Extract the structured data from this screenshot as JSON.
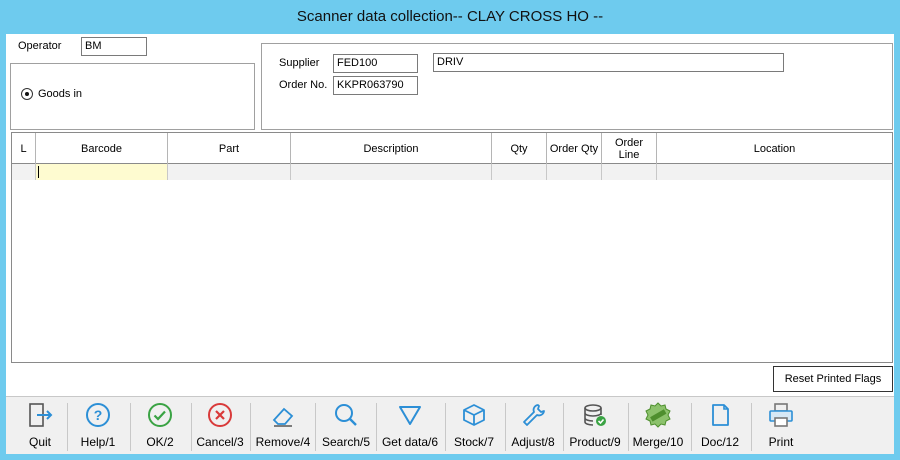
{
  "window": {
    "title": "Scanner data collection-- CLAY CROSS HO --"
  },
  "operator": {
    "label": "Operator",
    "value": "BM"
  },
  "mode": {
    "label": "Goods in",
    "selected": true
  },
  "supplier": {
    "label": "Supplier",
    "code": "FED100",
    "name": "DRIV"
  },
  "order": {
    "label": "Order No.",
    "value": "KKPR063790"
  },
  "grid": {
    "columns": [
      "L",
      "Barcode",
      "Part",
      "Description",
      "Qty",
      "Order Qty",
      "Order\nLine",
      "Location"
    ],
    "rows": [
      [
        "",
        "",
        "",
        "",
        "",
        "",
        "",
        ""
      ]
    ]
  },
  "reset_button": "Reset Printed Flags",
  "toolbar": [
    {
      "label": "Quit",
      "icon": "exit-door-icon"
    },
    {
      "label": "Help/1",
      "icon": "help-icon"
    },
    {
      "label": "OK/2",
      "icon": "check-circle-icon"
    },
    {
      "label": "Cancel/3",
      "icon": "cancel-circle-icon"
    },
    {
      "label": "Remove/4",
      "icon": "eraser-icon"
    },
    {
      "label": "Search/5",
      "icon": "magnifier-icon"
    },
    {
      "label": "Get data/6",
      "icon": "funnel-icon"
    },
    {
      "label": "Stock/7",
      "icon": "box-icon"
    },
    {
      "label": "Adjust/8",
      "icon": "wrench-icon"
    },
    {
      "label": "Product/9",
      "icon": "database-check-icon"
    },
    {
      "label": "Merge/10",
      "icon": "special-badge-icon"
    },
    {
      "label": "Doc/12",
      "icon": "document-icon"
    },
    {
      "label": "Print",
      "icon": "printer-icon"
    }
  ],
  "colors": {
    "title_bar": "#6ecbee",
    "active_cell": "#fefbd0",
    "icon_blue": "#2c8fd6",
    "icon_green": "#3aa344",
    "icon_red": "#d93a3a"
  }
}
